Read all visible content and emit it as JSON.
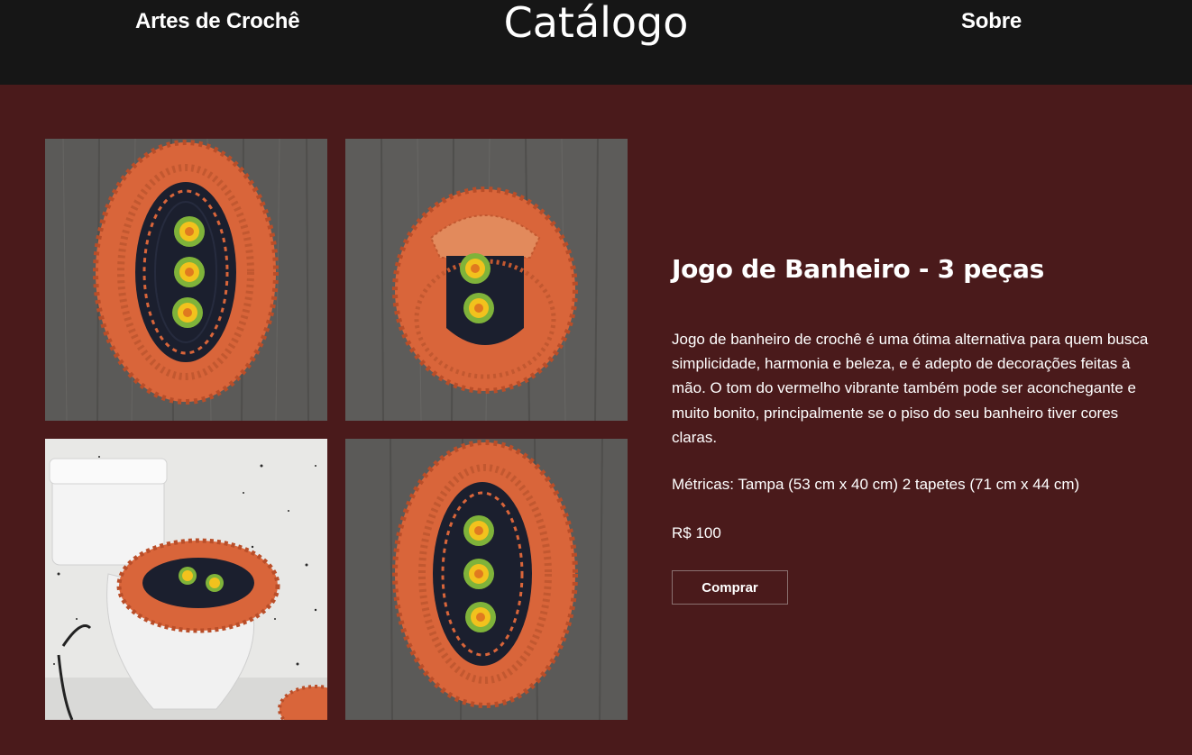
{
  "nav": {
    "left_link": "Artes de Crochê",
    "brand": "Catálogo",
    "right_link": "Sobre"
  },
  "product": {
    "title": "Jogo de Banheiro - 3 peças",
    "description": "Jogo de banheiro de crochê é uma ótima alternativa para quem busca simplicidade, harmonia e beleza, e é adepto de decorações feitas à mão. O tom do vermelho vibrante também pode ser aconchegante e muito bonito, principalmente se o piso do seu banheiro tiver cores claras.",
    "metrics": "Métricas: Tampa (53 cm x 40 cm) 2 tapetes (71 cm x 44 cm)",
    "price": "R$ 100",
    "buy_label": "Comprar"
  },
  "colors": {
    "page_background": "#4a1a1b",
    "topbar_background": "#161616",
    "crochet_orange": "#d9653a",
    "crochet_navy": "#1b1f2e",
    "flower_yellow": "#f2c21d",
    "flower_green": "#7fb33a"
  },
  "gallery": [
    {
      "alt": "oval-rug-on-wood"
    },
    {
      "alt": "lid-cover-on-wood"
    },
    {
      "alt": "toilet-with-lid-cover"
    },
    {
      "alt": "oval-rug-on-wood-2"
    }
  ]
}
